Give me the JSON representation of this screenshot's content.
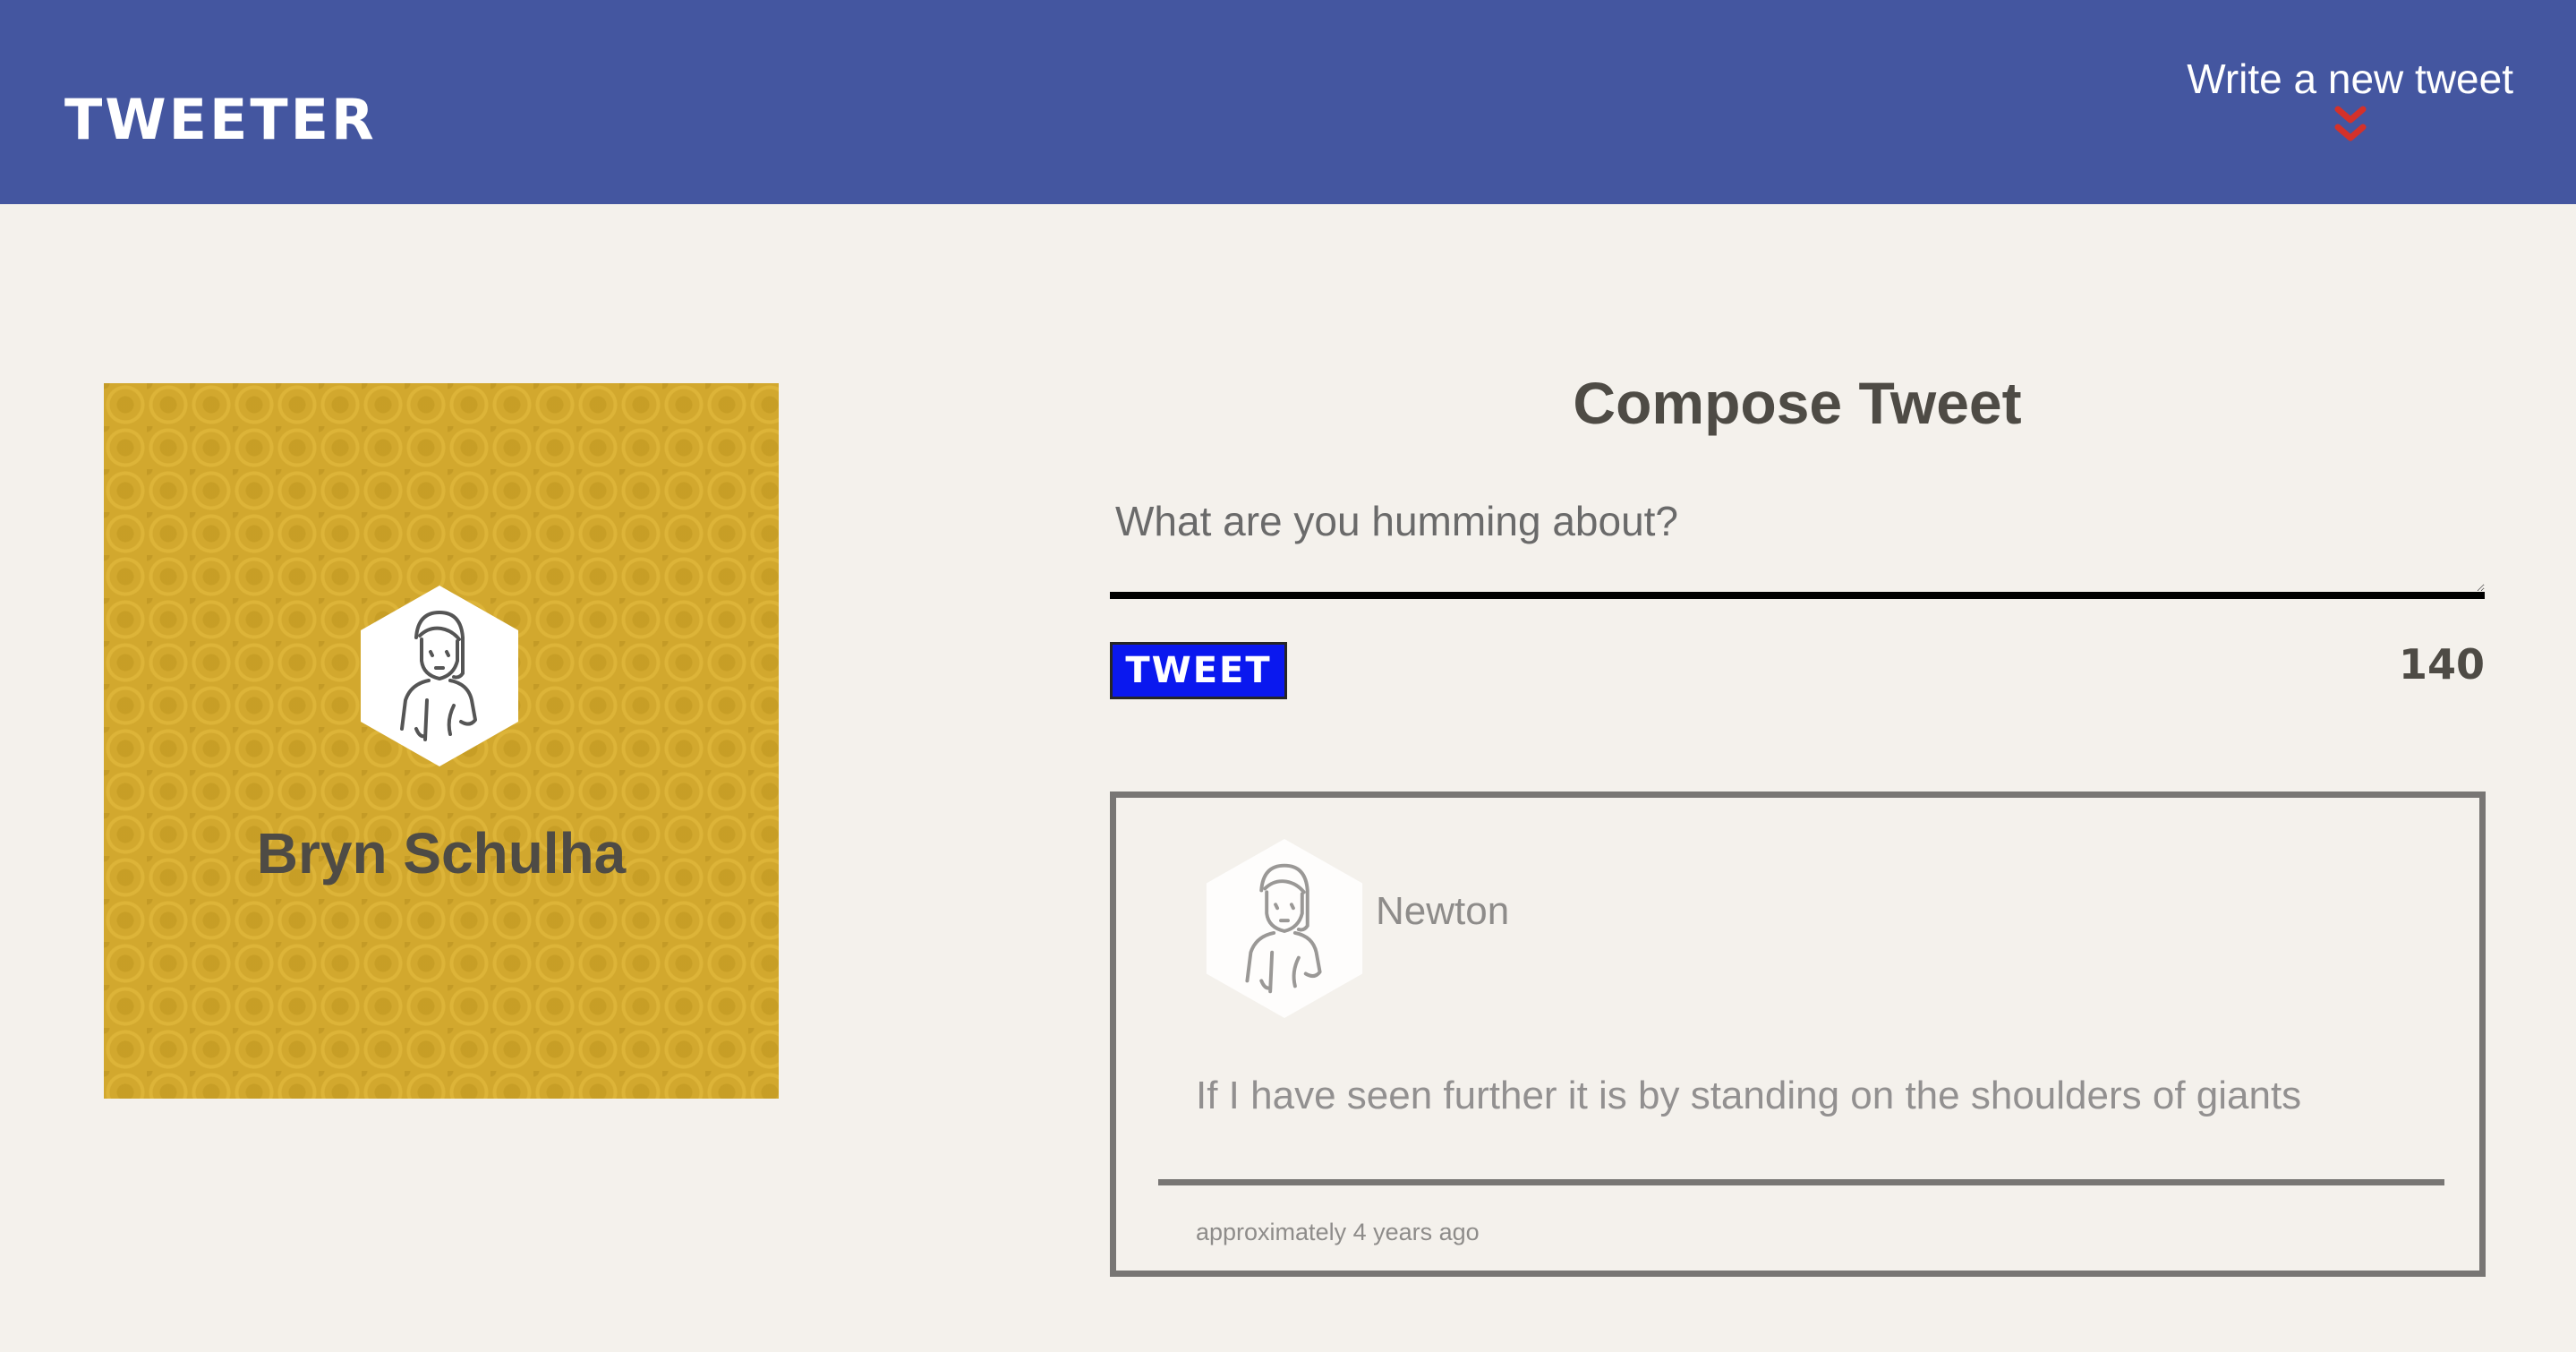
{
  "header": {
    "logo": "TWEETER",
    "new_tweet_label": "Write a new tweet",
    "accent_color": "#d4312a",
    "background_color": "#4456a0",
    "new_tweet_icon": "double-chevron-down-icon"
  },
  "profile": {
    "name": "Bryn Schulha",
    "avatar_icon": "user-avatar-icon",
    "background_color": "#d2a82e"
  },
  "compose": {
    "title": "Compose Tweet",
    "placeholder": "What are you humming about?",
    "value": "",
    "submit_label": "TWEET",
    "char_counter": "140",
    "button_color": "#0a18ef"
  },
  "tweets": [
    {
      "author": "Newton",
      "avatar_icon": "user-avatar-icon",
      "text": "If I have seen further it is by standing on the shoulders of giants",
      "timestamp": "approximately 4 years ago"
    }
  ]
}
